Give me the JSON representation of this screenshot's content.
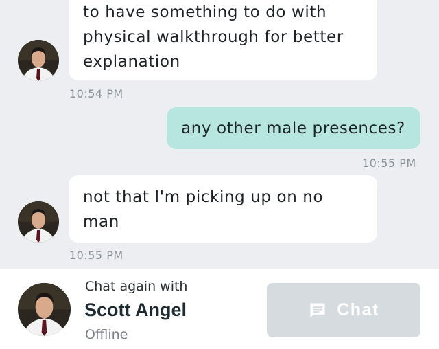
{
  "messages": [
    {
      "lines": [
        "to have something to do with",
        "physical walkthrough for better",
        "explanation"
      ],
      "time": "10:54 PM"
    },
    {
      "lines": [
        "any other male presences?"
      ],
      "time": "10:55 PM"
    },
    {
      "lines": [
        "not that I'm picking up on no",
        "man"
      ],
      "time": "10:55 PM"
    }
  ],
  "footer": {
    "prompt": "Chat again with",
    "contact_name": "Scott Angel",
    "status": "Offline",
    "chat_button_label": "Chat",
    "chat_icon": "message-bubble-icon"
  },
  "colors": {
    "background": "#eceef1",
    "incoming_bubble": "#ffffff",
    "outgoing_bubble": "#b7e6e1",
    "chat_button_disabled": "#d6dbe0"
  }
}
